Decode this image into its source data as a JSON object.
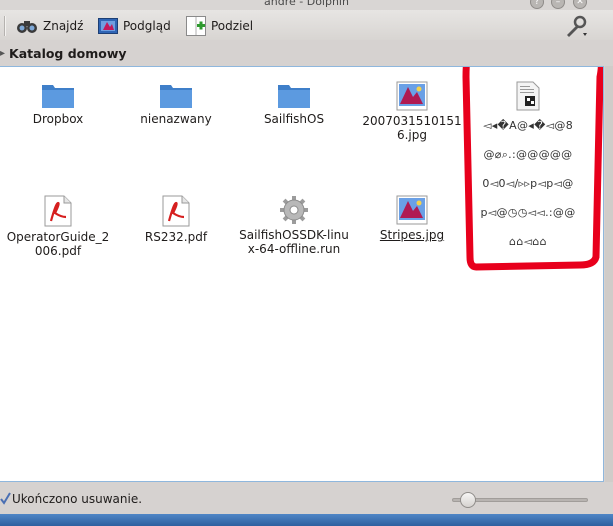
{
  "window": {
    "title": "andre - Dolphin",
    "controls": [
      "help-icon",
      "minimize-icon",
      "close-icon"
    ]
  },
  "toolbar": {
    "find_label": "Znajdź",
    "preview_label": "Podgląd",
    "split_label": "Podziel",
    "tools_icon": "wrench-icon"
  },
  "location": {
    "label": "Katalog domowy"
  },
  "files": [
    {
      "name": "Dropbox",
      "type": "folder"
    },
    {
      "name": "nienazwany",
      "type": "folder"
    },
    {
      "name": "SailfishOS",
      "type": "folder"
    },
    {
      "name": "20070315101516.jpg",
      "type": "image"
    },
    {
      "name": "OperatorGuide_2006.pdf",
      "type": "pdf"
    },
    {
      "name": "RS232.pdf",
      "type": "pdf"
    },
    {
      "name": "SailfishOSSDK-linux-64-offline.run",
      "type": "executable"
    },
    {
      "name": "Stripes.jpg",
      "type": "image"
    }
  ],
  "preview_panel": {
    "lines": [
      "◅◂�A@◂�◅@8",
      "@⌀⌕.:@@@@@",
      "0◅0◅∕▹▹p◅p◅@",
      "p◅@◷◷◅◅.:@@",
      "⌂⌂◅⌂⌂"
    ],
    "highlight_color": "#e8001c"
  },
  "status": {
    "message": "Ukończono usuwanie.",
    "zoom_level": 0.1
  },
  "colors": {
    "folder": "#4d8fd6",
    "accent": "#3a7bd5",
    "taskbar": "#3a6fb0"
  }
}
